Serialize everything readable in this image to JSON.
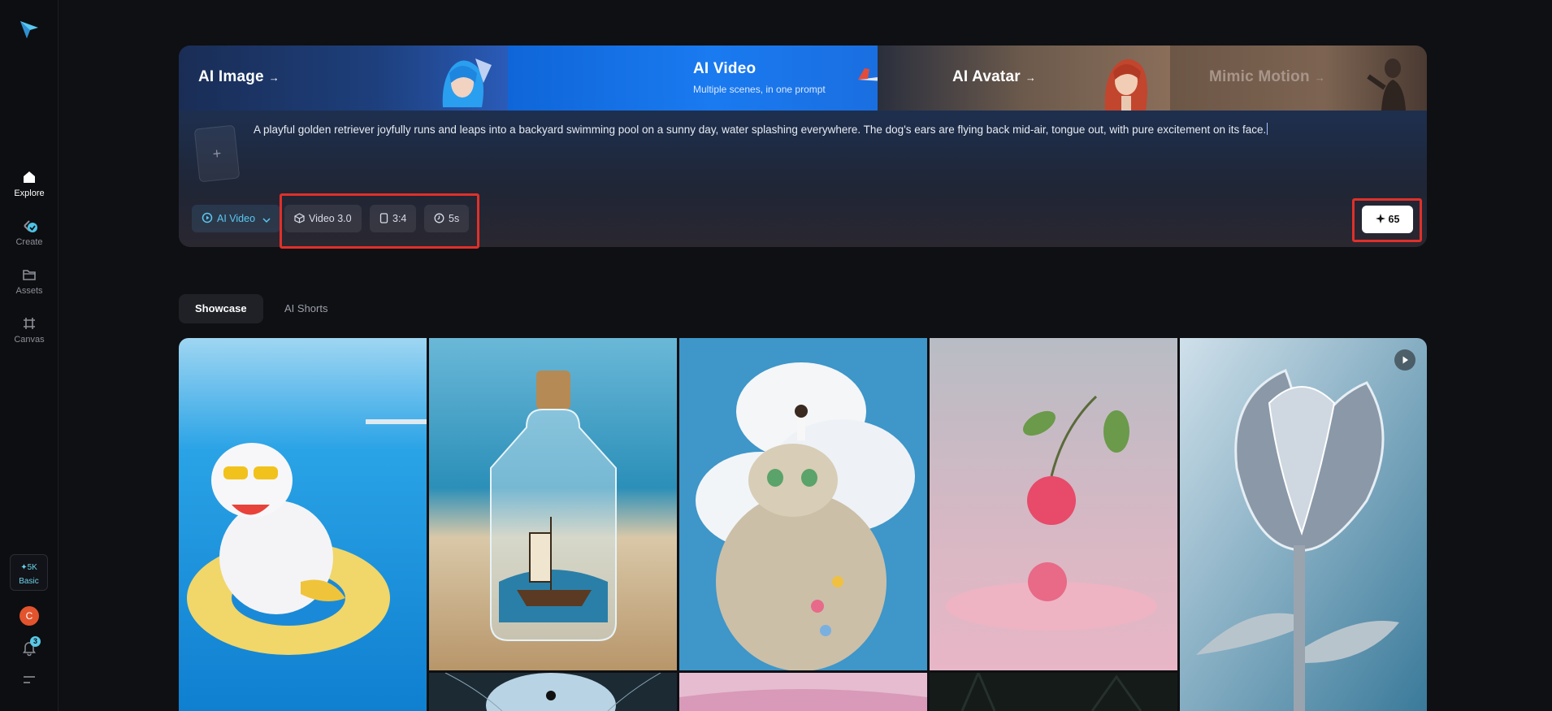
{
  "sidebar": {
    "items": [
      {
        "label": "Explore",
        "icon": "home-icon",
        "active": true
      },
      {
        "label": "Create",
        "icon": "create-icon",
        "active": false
      },
      {
        "label": "Assets",
        "icon": "folder-icon",
        "active": false
      },
      {
        "label": "Canvas",
        "icon": "canvas-icon",
        "active": false
      }
    ],
    "credits": {
      "amount": "✦5K",
      "plan": "Basic"
    },
    "avatar_initial": "C",
    "notifications_count": "3"
  },
  "hero": {
    "tabs": [
      {
        "label": "AI Image",
        "arrow": "→"
      },
      {
        "label": "AI Video",
        "subtitle": "Multiple scenes, in one prompt"
      },
      {
        "label": "AI Avatar",
        "arrow": "→"
      },
      {
        "label": "Mimic Motion",
        "arrow": "→"
      }
    ],
    "prompt_text": "A playful golden retriever joyfully runs and leaps into a backyard swimming pool on a sunny day, water splashing everywhere. The dog's ears are flying back mid-air, tongue out, with pure excitement on its face.",
    "mode": "AI Video",
    "model": "Video 3.0",
    "ratio": "3:4",
    "duration": "5s",
    "generate_cost": "65"
  },
  "showcase_tabs": [
    {
      "label": "Showcase",
      "active": true
    },
    {
      "label": "AI Shorts",
      "active": false
    }
  ],
  "colors": {
    "accent": "#5ac8f0",
    "highlight": "#e0302a",
    "video_tab": "#1a7af0"
  }
}
